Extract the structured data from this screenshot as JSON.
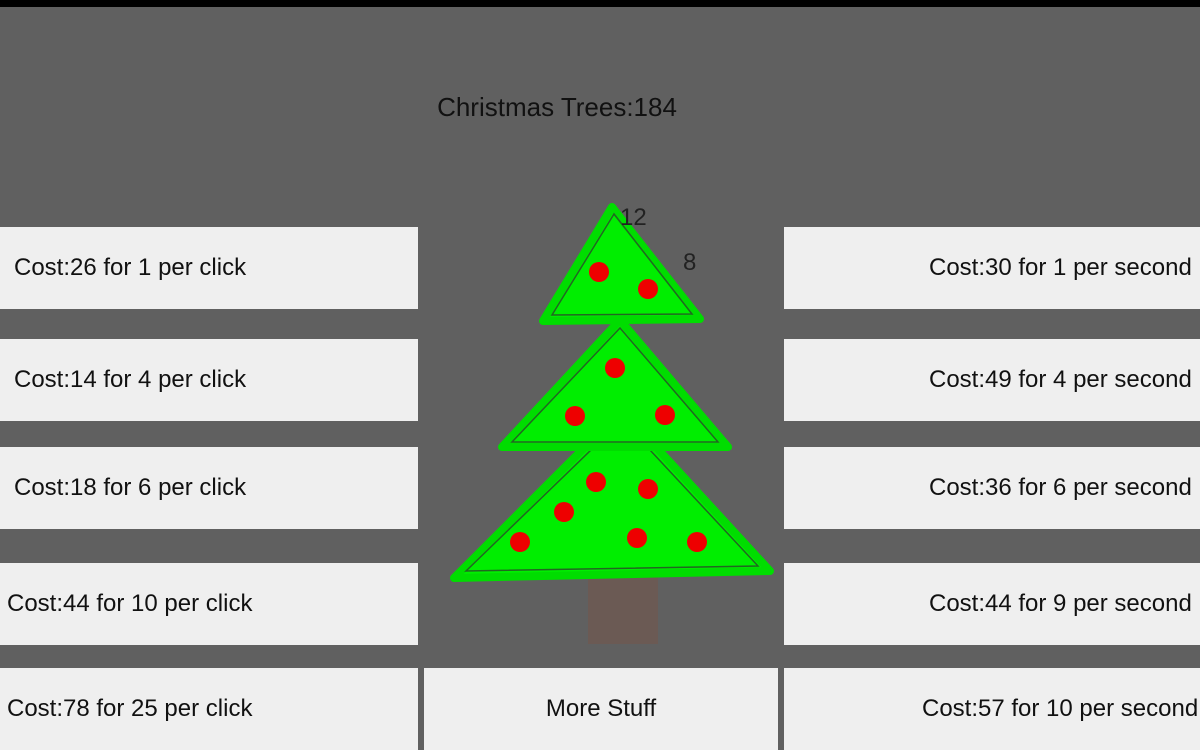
{
  "counter": "Christmas Trees:184",
  "click_upgrades": [
    "Cost:26 for 1 per click",
    "Cost:14 for 4 per click",
    "Cost:18 for 6 per click",
    "Cost:44 for 10 per click",
    "Cost:78 for 25 per click"
  ],
  "second_upgrades": [
    "Cost:30 for 1 per second",
    "Cost:49 for 4 per second",
    "Cost:36 for 6 per second",
    "Cost:44 for 9 per second",
    "Cost:57 for 10 per second"
  ],
  "more_button": "More Stuff",
  "floating_numbers": [
    "12",
    "8"
  ],
  "colors": {
    "background": "#606060",
    "button": "#efefef",
    "tree": "#00ee00",
    "ornament": "#ee0000",
    "trunk": "#6b5a54"
  }
}
